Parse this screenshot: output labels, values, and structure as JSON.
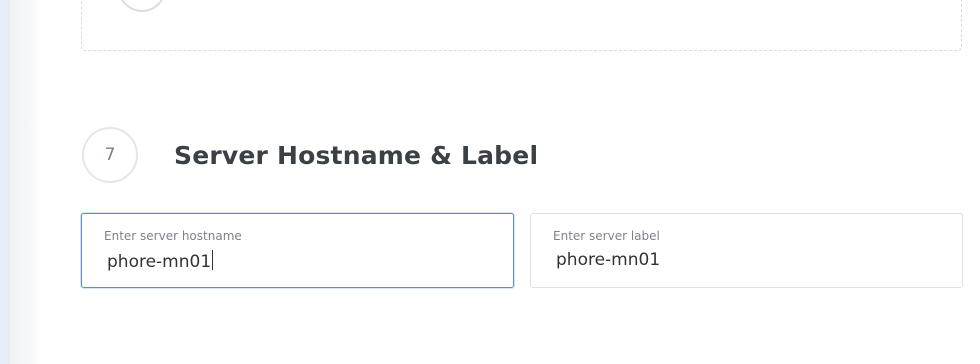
{
  "previous_step": {
    "number": ""
  },
  "step": {
    "number": "7",
    "title": "Server Hostname & Label"
  },
  "fields": {
    "hostname": {
      "caption": "Enter server hostname",
      "value": "phore-mn01",
      "focused": true
    },
    "label": {
      "caption": "Enter server label",
      "value": "phore-mn01",
      "focused": false
    }
  },
  "colors": {
    "focus_border": "#5a8fd6",
    "title_text": "#3b4047",
    "caption_text": "#7c838c",
    "rail": "#e8edf7"
  }
}
